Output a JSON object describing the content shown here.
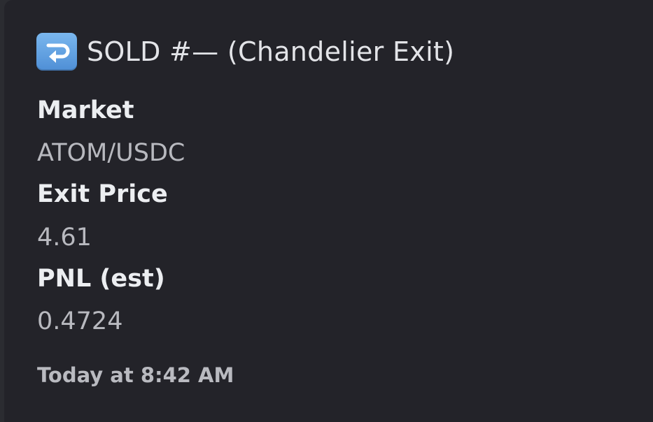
{
  "embed": {
    "title": "SOLD #— (Chandelier Exit)",
    "title_icon": "return-arrow-icon",
    "accent_color": "#5f9ee3",
    "fields": [
      {
        "name": "Market",
        "value": "ATOM/USDC"
      },
      {
        "name": "Exit Price",
        "value": "4.61"
      },
      {
        "name": "PNL (est)",
        "value": "0.4724"
      }
    ],
    "footer": "Today at 8:42 AM"
  }
}
